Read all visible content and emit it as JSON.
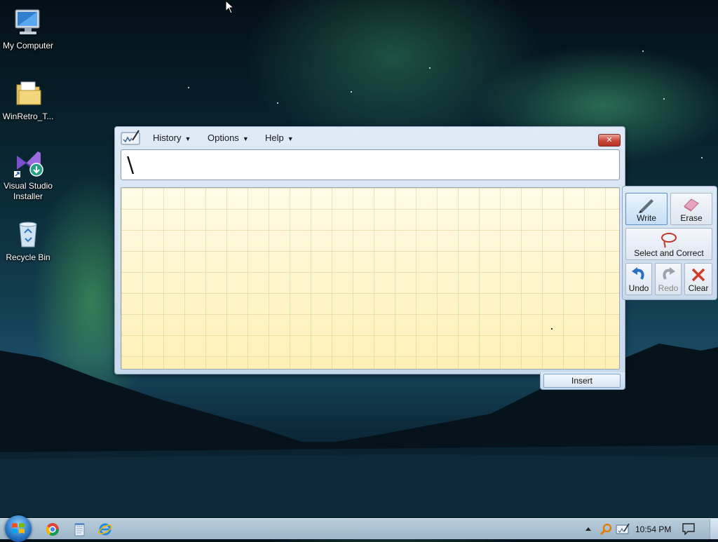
{
  "desktop": {
    "icons": [
      {
        "label": "My Computer",
        "icon": "computer-icon"
      },
      {
        "label": "WinRetro_T...",
        "icon": "folder-icon"
      },
      {
        "label": "Visual Studio Installer",
        "icon": "visual-studio-installer-icon"
      },
      {
        "label": "Recycle Bin",
        "icon": "recycle-bin-icon"
      }
    ]
  },
  "tip": {
    "menu": {
      "history": "History",
      "options": "Options",
      "help": "Help"
    },
    "close_label": "✕",
    "recognized_text": "\\",
    "tools": {
      "write": "Write",
      "erase": "Erase",
      "select_correct": "Select and Correct",
      "undo": "Undo",
      "redo": "Redo",
      "clear": "Clear"
    },
    "insert_label": "Insert"
  },
  "taskbar": {
    "pinned": [
      "chrome-icon",
      "notepad-icon",
      "internet-explorer-icon"
    ],
    "tray": [
      "show-hidden-icons-arrow",
      "search-tray-icon",
      "tablet-input-icon"
    ],
    "clock": "10:54 PM",
    "action_center": "action-center-icon"
  },
  "colors": {
    "window_frame": "#c9d9ec",
    "pad_background": "#fff3c4",
    "close_red": "#c9463a"
  }
}
